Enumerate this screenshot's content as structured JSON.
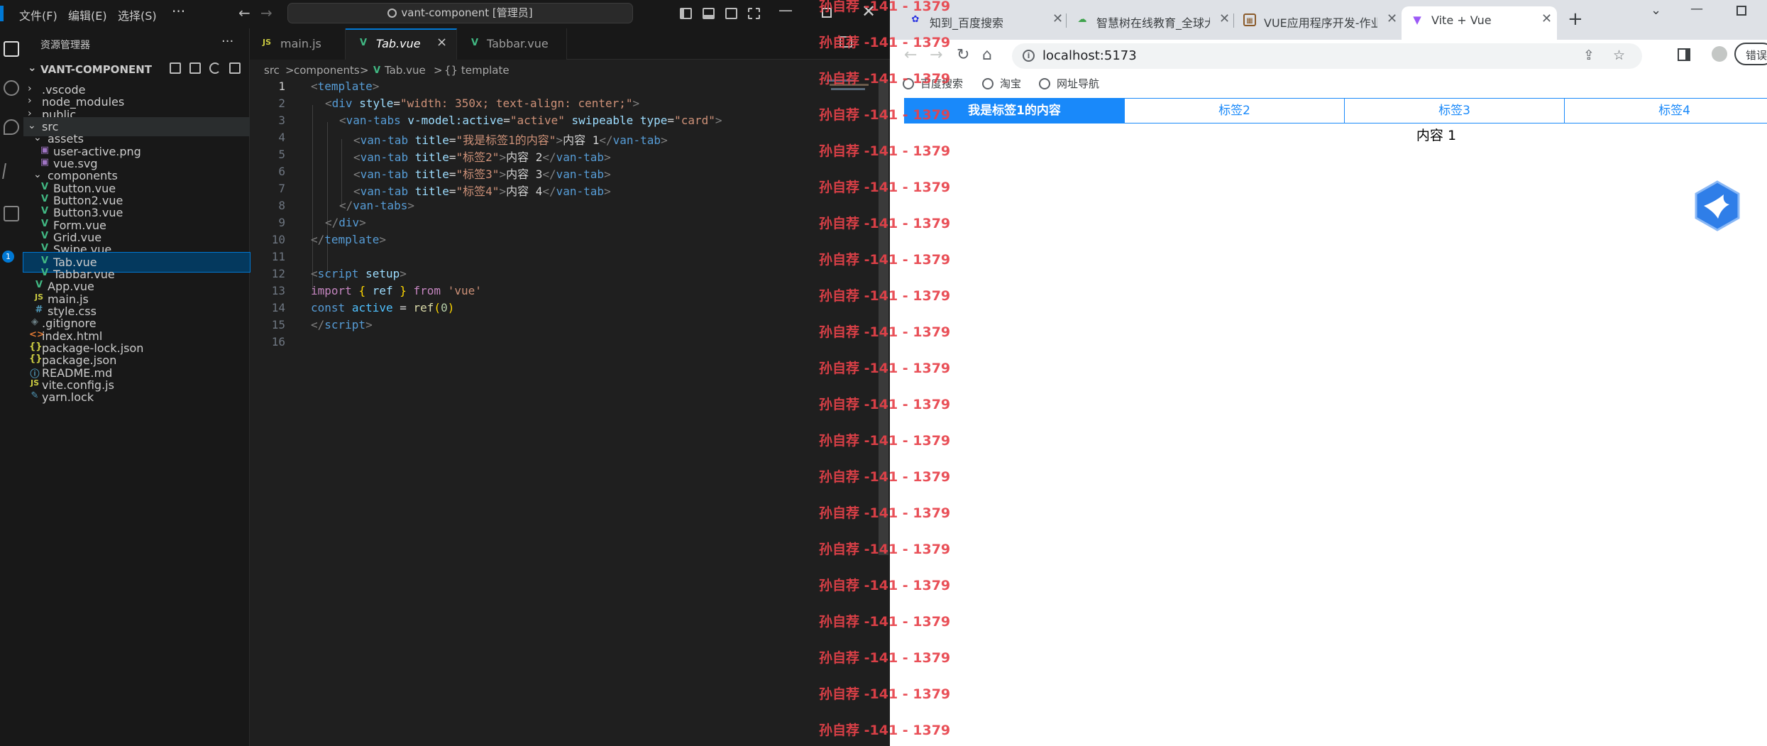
{
  "vscode": {
    "menu": [
      "文件(F)",
      "编辑(E)",
      "选择(S)",
      "···"
    ],
    "command_center": "vant-component [管理员]",
    "activity_badge": "1",
    "sidebar": {
      "title": "资源管理器",
      "more": "···",
      "root": "VANT-COMPONENT",
      "items": [
        {
          "label": ".vscode",
          "type": "folder",
          "depth": 1,
          "open": false
        },
        {
          "label": "node_modules",
          "type": "folder",
          "depth": 1,
          "open": false
        },
        {
          "label": "public",
          "type": "folder",
          "depth": 1,
          "open": false
        },
        {
          "label": "src",
          "type": "folder",
          "depth": 1,
          "open": true
        },
        {
          "label": "assets",
          "type": "folder",
          "depth": 2,
          "open": true
        },
        {
          "label": "user-active.png",
          "type": "png",
          "depth": 3
        },
        {
          "label": "vue.svg",
          "type": "svg",
          "depth": 3
        },
        {
          "label": "components",
          "type": "folder",
          "depth": 2,
          "open": true
        },
        {
          "label": "Button.vue",
          "type": "vue",
          "depth": 3
        },
        {
          "label": "Button2.vue",
          "type": "vue",
          "depth": 3
        },
        {
          "label": "Button3.vue",
          "type": "vue",
          "depth": 3
        },
        {
          "label": "Form.vue",
          "type": "vue",
          "depth": 3
        },
        {
          "label": "Grid.vue",
          "type": "vue",
          "depth": 3
        },
        {
          "label": "Swipe.vue",
          "type": "vue",
          "depth": 3
        },
        {
          "label": "Tab.vue",
          "type": "vue",
          "depth": 3,
          "selected": true
        },
        {
          "label": "Tabbar.vue",
          "type": "vue",
          "depth": 3
        },
        {
          "label": "App.vue",
          "type": "vue",
          "depth": 2
        },
        {
          "label": "main.js",
          "type": "js",
          "depth": 2
        },
        {
          "label": "style.css",
          "type": "css",
          "depth": 2
        },
        {
          "label": ".gitignore",
          "type": "git",
          "depth": 1
        },
        {
          "label": "index.html",
          "type": "html",
          "depth": 1
        },
        {
          "label": "package-lock.json",
          "type": "json",
          "depth": 1
        },
        {
          "label": "package.json",
          "type": "json",
          "depth": 1
        },
        {
          "label": "README.md",
          "type": "md",
          "depth": 1
        },
        {
          "label": "vite.config.js",
          "type": "js",
          "depth": 1
        },
        {
          "label": "yarn.lock",
          "type": "yarn",
          "depth": 1
        }
      ]
    },
    "tabs": [
      {
        "label": "main.js",
        "icon": "JS"
      },
      {
        "label": "Tab.vue",
        "icon": "V",
        "active": true,
        "close": "×"
      },
      {
        "label": "Tabbar.vue",
        "icon": "V"
      }
    ],
    "breadcrumb": [
      "src",
      ">",
      "components",
      ">",
      "Tab.vue",
      ">",
      "{} template"
    ],
    "code": {
      "line_numbers": [
        "1",
        "2",
        "3",
        "4",
        "5",
        "6",
        "7",
        "8",
        "9",
        "10",
        "11",
        "12",
        "13",
        "14",
        "15",
        "16"
      ],
      "l1": [
        "<",
        "template",
        ">"
      ],
      "l2": [
        "<",
        "div",
        " ",
        "style",
        "=",
        "\"width: 350x; text-align: center;\"",
        ">"
      ],
      "l3": [
        "<",
        "van-tabs",
        " ",
        "v-model:active",
        "=",
        "\"active\"",
        " ",
        "swipeable",
        " ",
        "type",
        "=",
        "\"card\"",
        ">"
      ],
      "l4": [
        "<",
        "van-tab",
        " ",
        "title",
        "=",
        "\"我是标签1的内容\"",
        ">",
        "内容 1",
        "</",
        "van-tab",
        ">"
      ],
      "l5": [
        "<",
        "van-tab",
        " ",
        "title",
        "=",
        "\"标签2\"",
        ">",
        "内容 2",
        "</",
        "van-tab",
        ">"
      ],
      "l6": [
        "<",
        "van-tab",
        " ",
        "title",
        "=",
        "\"标签3\"",
        ">",
        "内容 3",
        "</",
        "van-tab",
        ">"
      ],
      "l7": [
        "<",
        "van-tab",
        " ",
        "title",
        "=",
        "\"标签4\"",
        ">",
        "内容 4",
        "</",
        "van-tab",
        ">"
      ],
      "l8": [
        "</",
        "van-tabs",
        ">"
      ],
      "l9": [
        "</",
        "div",
        ">"
      ],
      "l10": [
        "</",
        "template",
        ">"
      ],
      "l12": [
        "<",
        "script",
        " ",
        "setup",
        ">"
      ],
      "l13": [
        "import",
        " ",
        "{",
        " ref ",
        "}",
        " ",
        "from",
        " ",
        "'vue'"
      ],
      "l14": [
        "const",
        " ",
        "active",
        " = ",
        "ref",
        "(",
        "0",
        ")"
      ],
      "l15": [
        "</",
        "script",
        ">"
      ]
    }
  },
  "chrome": {
    "tabs": [
      {
        "label": "知到_百度搜索",
        "favicon": "baidu-icon"
      },
      {
        "label": "智慧树在线教育_全球大",
        "favicon": "zhihuishu-icon"
      },
      {
        "label": "VUE应用程序开发-作业",
        "favicon": "page-icon"
      },
      {
        "label": "Vite + Vue",
        "favicon": "vite-icon",
        "active": true
      }
    ],
    "new_tab": "+",
    "url": "localhost:5173",
    "extension_button": "错误",
    "bookmarks": [
      "百度搜索",
      "淘宝",
      "网址导航"
    ],
    "page": {
      "tabs": [
        "我是标签1的内容",
        "标签2",
        "标签3",
        "标签4"
      ],
      "active_tab": 0,
      "content": "内容 1"
    }
  },
  "watermark": "孙自荐 -141 - 1379",
  "colors": {
    "vant_blue": "#1989fa",
    "vscode_accent": "#0078d4",
    "watermark_red": "#e8424a"
  }
}
